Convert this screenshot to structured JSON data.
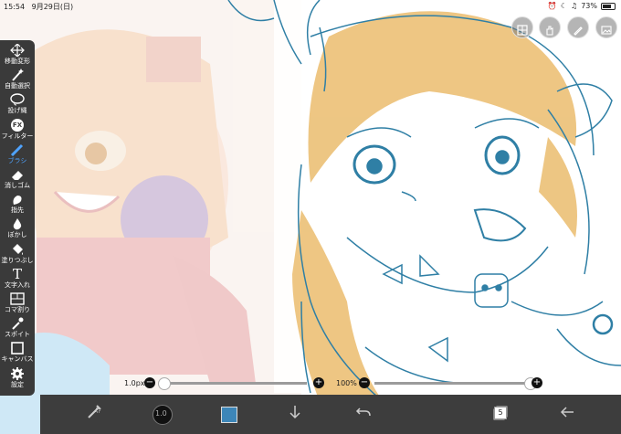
{
  "status_bar": {
    "time": "15:54",
    "date": "9月29日(日)",
    "battery_percent": "73%",
    "battery_level": 0.73
  },
  "tools": [
    {
      "name": "move",
      "label": "移動変形",
      "icon": "move-arrows-icon"
    },
    {
      "name": "auto-select",
      "label": "自動選択",
      "icon": "magic-wand-icon"
    },
    {
      "name": "lasso",
      "label": "投げ縄",
      "icon": "lasso-icon"
    },
    {
      "name": "filter",
      "label": "フィルター",
      "icon": "fx-icon",
      "glyph": "FX"
    },
    {
      "name": "brush",
      "label": "ブラシ",
      "icon": "brush-icon",
      "active": true
    },
    {
      "name": "eraser",
      "label": "消しゴム",
      "icon": "eraser-icon"
    },
    {
      "name": "finger",
      "label": "指先",
      "icon": "finger-icon"
    },
    {
      "name": "blur",
      "label": "ぼかし",
      "icon": "blur-drop-icon"
    },
    {
      "name": "fill",
      "label": "塗りつぶし",
      "icon": "bucket-icon"
    },
    {
      "name": "text",
      "label": "文字入れ",
      "icon": "text-icon",
      "glyph": "T"
    },
    {
      "name": "frame",
      "label": "コマ割り",
      "icon": "frame-divide-icon"
    },
    {
      "name": "eyedropper",
      "label": "スポイト",
      "icon": "eyedropper-icon"
    },
    {
      "name": "canvas",
      "label": "キャンバス",
      "icon": "canvas-icon"
    },
    {
      "name": "settings",
      "label": "設定",
      "icon": "gear-icon"
    }
  ],
  "sliders": {
    "brush_size": {
      "label": "1.0px",
      "minus": "−",
      "plus": "+",
      "value_fraction": 0.02
    },
    "opacity": {
      "label": "100%",
      "minus": "−",
      "plus": "+",
      "value_fraction": 1.0
    }
  },
  "bottom_bar": {
    "brush_size_badge": "1.0",
    "layer_count": "5",
    "color_swatch": "#3d86b8"
  },
  "colors": {
    "toolbar_bg": "#3a3a3a",
    "active_tool": "#4fa3ff",
    "line_blue": "#2f7fa5",
    "line_orange": "#e8a33a"
  }
}
